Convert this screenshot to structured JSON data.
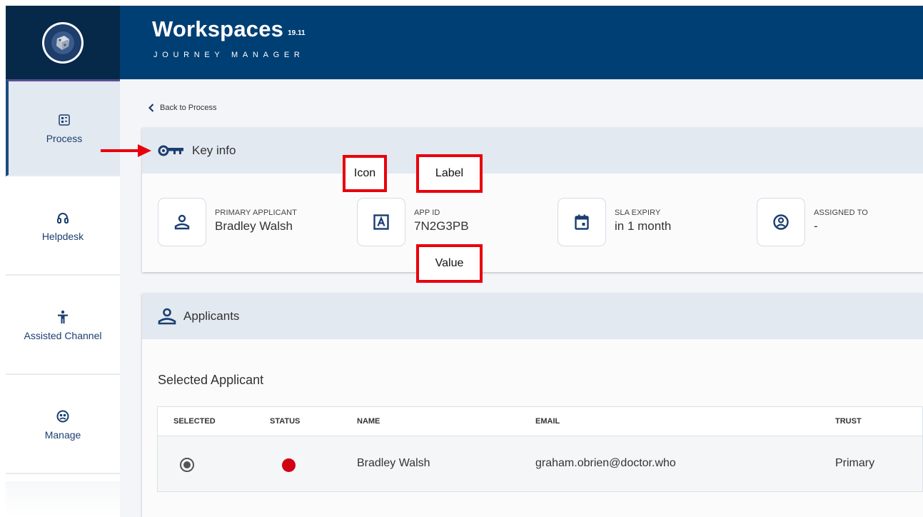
{
  "header": {
    "title": "Workspaces",
    "version": "19.11",
    "subtitle": "JOURNEY MANAGER"
  },
  "sidebar": {
    "items": [
      {
        "label": "Process",
        "icon": "process-icon",
        "active": true
      },
      {
        "label": "Helpdesk",
        "icon": "headset-icon",
        "active": false
      },
      {
        "label": "Assisted Channel",
        "icon": "accessibility-icon",
        "active": false
      },
      {
        "label": "Manage",
        "icon": "manage-icon",
        "active": false
      }
    ]
  },
  "main": {
    "back_label": "Back to Process",
    "key_info": {
      "title": "Key info",
      "items": [
        {
          "label": "PRIMARY APPLICANT",
          "value": "Bradley Walsh",
          "icon": "person-icon"
        },
        {
          "label": "APP ID",
          "value": "7N2G3PB",
          "icon": "letter-a-icon"
        },
        {
          "label": "SLA EXPIRY",
          "value": "in 1 month",
          "icon": "calendar-icon"
        },
        {
          "label": "ASSIGNED TO",
          "value": "-",
          "icon": "user-circle-icon"
        }
      ]
    },
    "applicants": {
      "title": "Applicants",
      "selected_title": "Selected Applicant",
      "columns": [
        "SELECTED",
        "STATUS",
        "NAME",
        "EMAIL",
        "TRUST"
      ],
      "rows": [
        {
          "selected": true,
          "status_color": "#d10012",
          "name": "Bradley Walsh",
          "email": "graham.obrien@doctor.who",
          "trust": "Primary"
        }
      ]
    }
  },
  "annotations": {
    "icon": "Icon",
    "label": "Label",
    "value": "Value"
  },
  "colors": {
    "header_bg": "#003f74",
    "logo_bg": "#062849",
    "sidebar_text": "#1b3e70",
    "annotation": "#e8000c",
    "status_red": "#d10012"
  }
}
